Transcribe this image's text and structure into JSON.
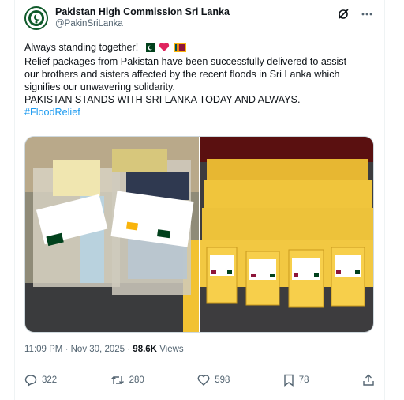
{
  "account": {
    "display_name": "Pakistan High Commission Sri Lanka",
    "handle": "@PakinSriLanka"
  },
  "post": {
    "line1": "Always standing together!",
    "line2": "Relief packages from Pakistan have been successfully delivered to assist",
    "line3": "our brothers and sisters affected by the recent floods in Sri Lanka which",
    "line4": "signifies our unwavering solidarity.",
    "line5": "PAKISTAN STANDS WITH SRI LANKA TODAY AND ALWAYS.",
    "hashtag": "#FloodRelief"
  },
  "meta": {
    "time": "11:09 PM",
    "separator": "·",
    "date": "Nov 30, 2025",
    "views_count": "98.6K",
    "views_label": "Views"
  },
  "actions": {
    "replies": "322",
    "reposts": "280",
    "likes": "598",
    "bookmarks": "78"
  },
  "colors": {
    "accent": "#1d9bf0",
    "muted": "#536471",
    "text": "#0f1419"
  },
  "icons": [
    "grok-icon",
    "more-icon",
    "reply-icon",
    "repost-icon",
    "like-icon",
    "bookmark-icon",
    "share-icon"
  ]
}
